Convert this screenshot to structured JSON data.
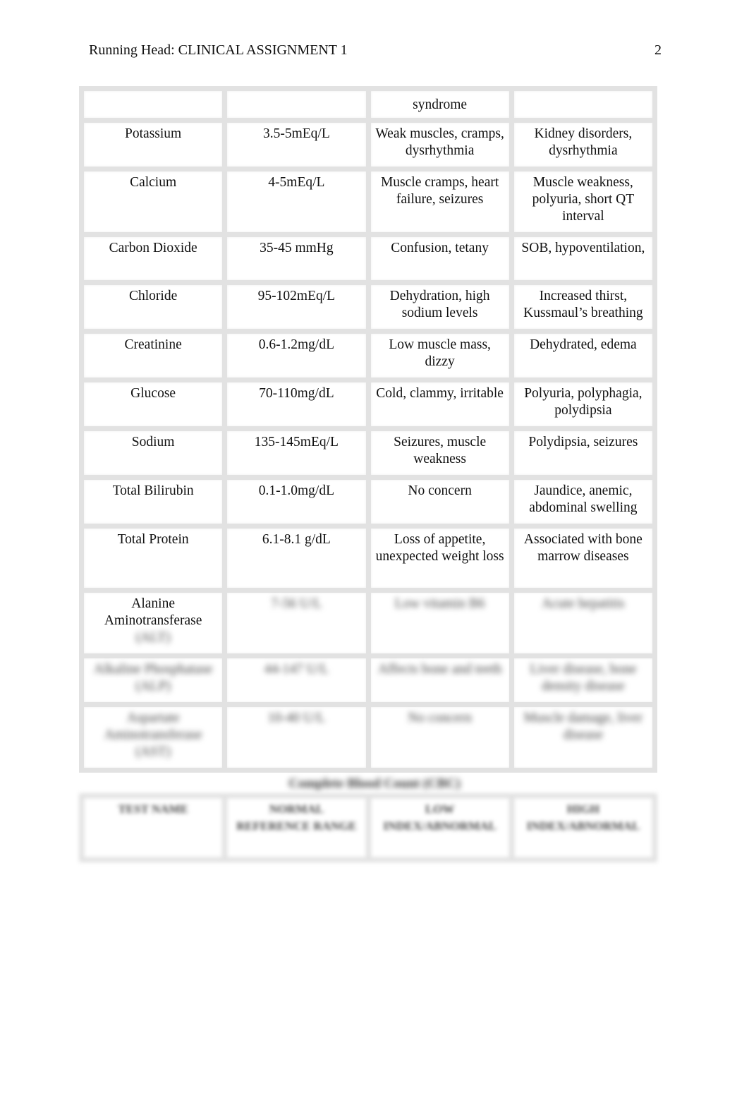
{
  "header": {
    "running_head": "Running Head: CLINICAL ASSIGNMENT 1",
    "page_number": "2"
  },
  "table1": {
    "rows": [
      [
        "",
        "",
        "syndrome",
        ""
      ],
      [
        "Potassium",
        "3.5-5mEq/L",
        "Weak muscles, cramps, dysrhythmia",
        "Kidney disorders, dysrhythmia"
      ],
      [
        "Calcium",
        "4-5mEq/L",
        "Muscle cramps, heart failure, seizures",
        "Muscle weakness, polyuria, short QT interval"
      ],
      [
        "Carbon Dioxide",
        "35-45 mmHg",
        "Confusion, tetany",
        "SOB, hypoventilation,"
      ],
      [
        "Chloride",
        "95-102mEq/L",
        "Dehydration, high sodium levels",
        "Increased thirst, Kussmaul’s breathing"
      ],
      [
        "Creatinine",
        "0.6-1.2mg/dL",
        "Low muscle mass, dizzy",
        "Dehydrated, edema"
      ],
      [
        "Glucose",
        "70-110mg/dL",
        "Cold, clammy, irritable",
        "Polyuria, polyphagia, polydipsia"
      ],
      [
        "Sodium",
        "135-145mEq/L",
        "Seizures, muscle weakness",
        "Polydipsia, seizures"
      ],
      [
        "Total Bilirubin",
        "0.1-1.0mg/dL",
        "No concern",
        "Jaundice, anemic, abdominal swelling"
      ],
      [
        "Total Protein",
        "6.1-8.1 g/dL",
        "Loss of appetite, unexpected weight loss",
        "Associated with bone marrow diseases"
      ]
    ],
    "alt_row": {
      "name_visible": "Alanine Aminotransferase",
      "name_blurred": "(ALT)",
      "range": "7-56 U/L",
      "low": "Low vitamin B6",
      "high": "Acute hepatitis"
    },
    "blurred_rows": [
      [
        "Alkaline Phosphatase (ALP)",
        "44-147 U/L",
        "Affects bone and teeth",
        "Liver disease, bone density disease"
      ],
      [
        "Aspartate Aminotransferase (AST)",
        "10-40 U/L",
        "No concern",
        "Muscle damage, liver disease"
      ]
    ]
  },
  "cbc": {
    "caption": "Complete Blood Count (CBC)",
    "headers": [
      "TEST NAME",
      "NORMAL REFERENCE RANGE",
      "LOW INDEX/ABNORMAL",
      "HIGH INDEX/ABNORMAL"
    ]
  }
}
